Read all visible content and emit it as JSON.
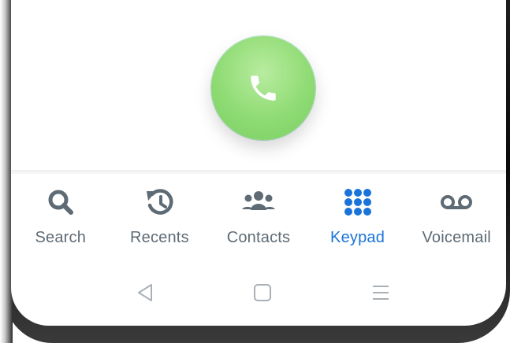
{
  "call": {
    "icon": "phone-icon",
    "color": "#8fdb74"
  },
  "tabs": [
    {
      "label": "Search",
      "icon": "search-icon",
      "active": false
    },
    {
      "label": "Recents",
      "icon": "history-icon",
      "active": false
    },
    {
      "label": "Contacts",
      "icon": "people-icon",
      "active": false
    },
    {
      "label": "Keypad",
      "icon": "keypad-icon",
      "active": true
    },
    {
      "label": "Voicemail",
      "icon": "voicemail-icon",
      "active": false
    }
  ],
  "navigation": {
    "back_icon": "back-triangle-icon",
    "home_icon": "home-square-icon",
    "menu_icon": "menu-lines-icon"
  },
  "colors": {
    "active": "#1a73d9",
    "inactive": "#5e6b75",
    "call_button": "#8fdb74"
  }
}
